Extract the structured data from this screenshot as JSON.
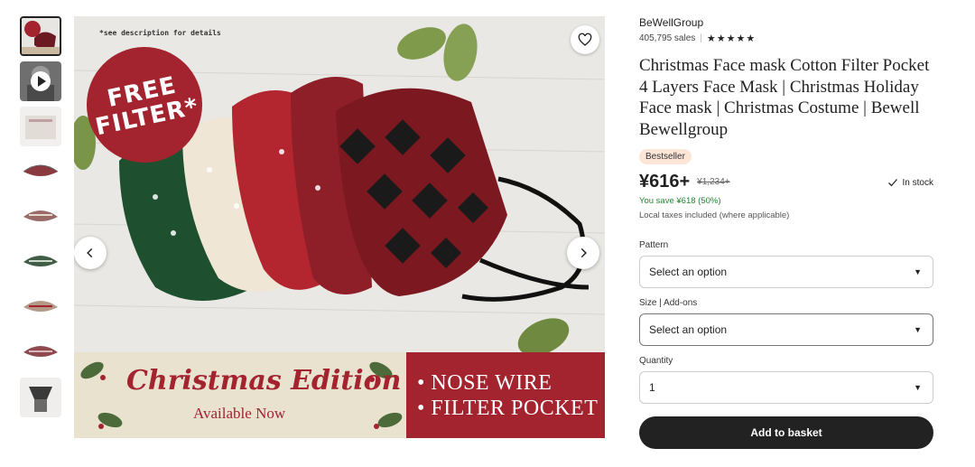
{
  "thumbnails": [
    {
      "kind": "photo",
      "color": "#a3232f"
    },
    {
      "kind": "video",
      "color": "#555555"
    },
    {
      "kind": "photo",
      "color": "#cfcac4"
    },
    {
      "kind": "mask",
      "color": "#8a3a3e"
    },
    {
      "kind": "mask",
      "color": "#9a6a66"
    },
    {
      "kind": "mask",
      "color": "#3f5e45"
    },
    {
      "kind": "mask",
      "color": "#b29a86"
    },
    {
      "kind": "mask",
      "color": "#8e4a4f"
    },
    {
      "kind": "photo",
      "color": "#3a3a3a"
    }
  ],
  "image": {
    "note": "*see description for details",
    "badge": "FREE\nFILTER*",
    "banner_title": "Christmas Edition",
    "banner_sub": "Available Now",
    "banner_line1": "• NOSE WIRE",
    "banner_line2": "• FILTER POCKET"
  },
  "shop": {
    "name": "BeWellGroup",
    "sales": "405,795 sales",
    "stars": "★★★★★"
  },
  "product": {
    "title": "Christmas Face mask Cotton Filter Pocket 4 Layers Face Mask | Christmas Holiday Face mask | Christmas Costume | Bewell Bewellgroup",
    "badge": "Bestseller",
    "price": "¥616+",
    "old_price": "¥1,234+",
    "stock": "In stock",
    "save": "You save ¥618 (50%)",
    "tax": "Local taxes included (where applicable)"
  },
  "options": {
    "pattern_label": "Pattern",
    "pattern_value": "Select an option",
    "size_label": "Size | Add-ons",
    "size_value": "Select an option",
    "quantity_label": "Quantity",
    "quantity_value": "1"
  },
  "actions": {
    "add_to_basket": "Add to basket"
  },
  "colors": {
    "accent_red": "#a3232f",
    "button_dark": "#222222",
    "success_green": "#258635",
    "bestseller_bg": "#fde5d7"
  }
}
